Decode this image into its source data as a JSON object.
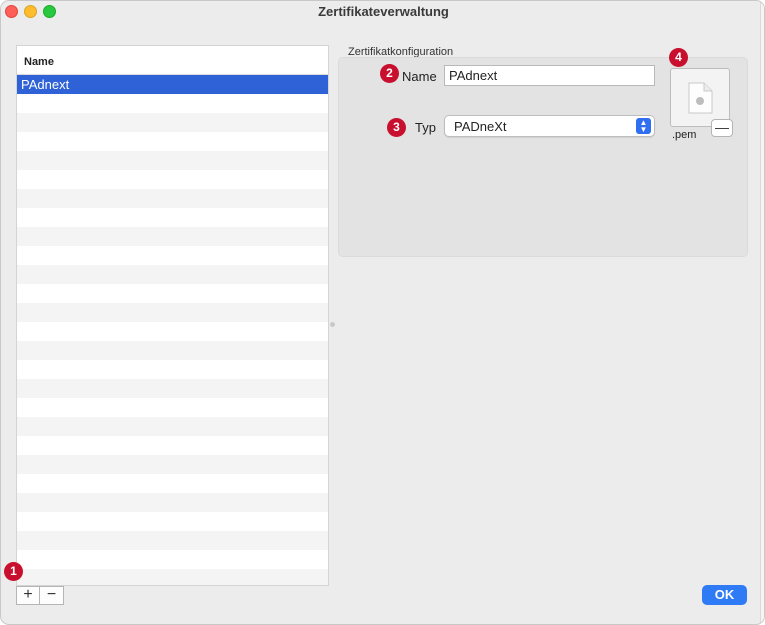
{
  "window": {
    "title": "Zertifikateverwaltung"
  },
  "certificate_list": {
    "column_header": "Name",
    "items": [
      "PAdnext"
    ],
    "add_label": "+",
    "remove_label": "−"
  },
  "config": {
    "group_label": "Zertifikatkonfiguration",
    "name_label": "Name",
    "name_value": "PAdnext",
    "type_label": "Typ",
    "type_value": "PADneXt",
    "file_extension": ".pem",
    "remove_file_label": "—"
  },
  "badges": [
    "1",
    "2",
    "3",
    "4"
  ],
  "footer": {
    "ok_label": "OK"
  },
  "colors": {
    "selection": "#2f62d7",
    "badge": "#c8102e",
    "accent": "#2f7bf5"
  }
}
